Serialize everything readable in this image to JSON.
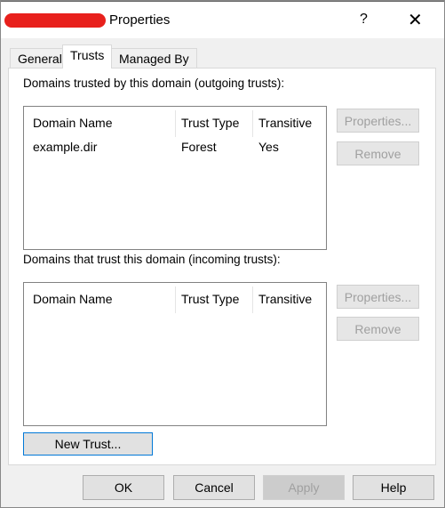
{
  "window": {
    "title": "Properties",
    "help": "?",
    "close": "✕"
  },
  "tabs": [
    {
      "label": "General"
    },
    {
      "label": "Trusts"
    },
    {
      "label": "Managed By"
    }
  ],
  "outgoing": {
    "label": "Domains trusted by this domain (outgoing trusts):",
    "columns": [
      "Domain Name",
      "Trust Type",
      "Transitive"
    ],
    "rows": [
      [
        "example.dir",
        "Forest",
        "Yes"
      ]
    ],
    "properties": "Properties...",
    "remove": "Remove"
  },
  "incoming": {
    "label": "Domains that trust this domain (incoming trusts):",
    "columns": [
      "Domain Name",
      "Trust Type",
      "Transitive"
    ],
    "properties": "Properties...",
    "remove": "Remove"
  },
  "new_trust": "New Trust...",
  "footer": {
    "ok": "OK",
    "cancel": "Cancel",
    "apply": "Apply",
    "help": "Help"
  }
}
